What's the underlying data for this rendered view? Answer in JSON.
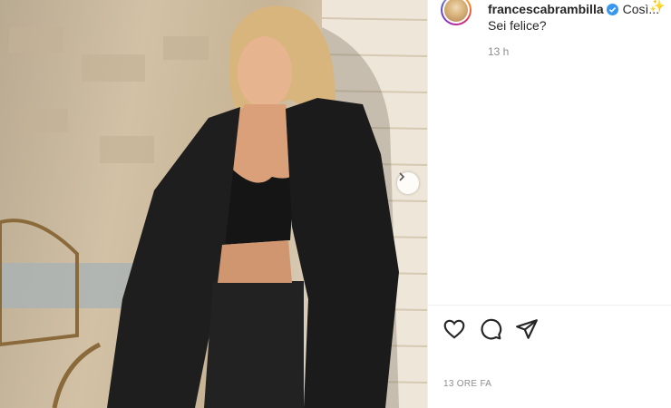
{
  "post": {
    "username": "francescabrambilla",
    "caption_start": "Così...",
    "caption_line2": "Sei felice?",
    "comment_age": "13 h",
    "posted_ago": "13 ORE FA"
  },
  "icons": {
    "like": "heart-icon",
    "comment": "comment-icon",
    "share": "share-icon",
    "next": "chevron-right-icon",
    "verified": "verified-badge-icon",
    "emoji": "sparkles-emoji"
  },
  "colors": {
    "verified_blue": "#3897f0",
    "text": "#262626",
    "muted": "#8e8e8e"
  }
}
